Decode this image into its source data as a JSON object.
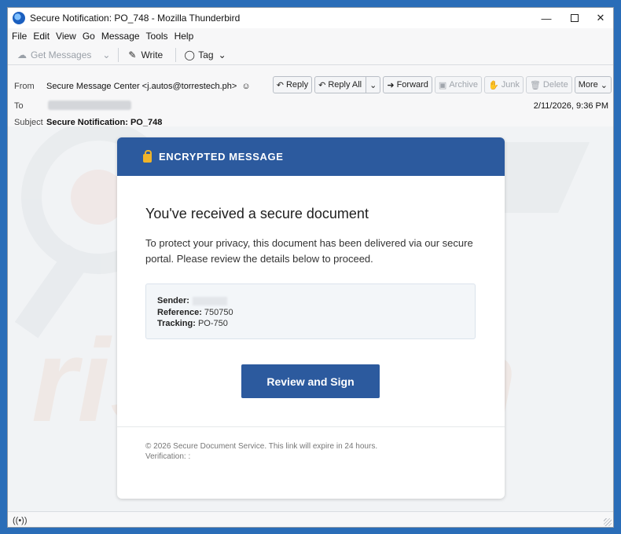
{
  "window": {
    "title": "Secure Notification: PO_748 - Mozilla Thunderbird"
  },
  "menu": [
    "File",
    "Edit",
    "View",
    "Go",
    "Message",
    "Tools",
    "Help"
  ],
  "toolbar": {
    "get_messages": "Get Messages",
    "write": "Write",
    "tag": "Tag"
  },
  "header": {
    "from_label": "From",
    "from_value": "Secure Message Center <j.autos@torrestech.ph>",
    "to_label": "To",
    "subject_label": "Subject",
    "subject_value": "Secure Notification: PO_748",
    "date": "2/11/2026, 9:36 PM",
    "actions": {
      "reply": "Reply",
      "reply_all": "Reply All",
      "forward": "Forward",
      "archive": "Archive",
      "junk": "Junk",
      "delete": "Delete",
      "more": "More"
    }
  },
  "email": {
    "banner": "ENCRYPTED MESSAGE",
    "title": "You've received a secure document",
    "body": "To protect your privacy, this document has been delivered via our secure portal. Please review the details below to proceed.",
    "details": {
      "sender_label": "Sender:",
      "reference_label": "Reference:",
      "reference_value": "750750",
      "tracking_label": "Tracking:",
      "tracking_value": "PO-750"
    },
    "cta": "Review and Sign",
    "footer_line1": "© 2026 Secure Document Service. This link will expire in 24 hours.",
    "footer_line2": "Verification: :"
  },
  "watermark": {
    "text": "risk.com"
  },
  "colors": {
    "accent": "#2c5a9e",
    "lock": "#f0b429",
    "desktop": "#2a6db8"
  },
  "icons": [
    "app-icon",
    "minimize-icon",
    "maximize-icon",
    "close-icon",
    "get-messages-icon",
    "write-icon",
    "tag-icon",
    "chevron-down-icon",
    "contact-icon",
    "reply-icon",
    "reply-all-icon",
    "forward-icon",
    "archive-icon",
    "junk-icon",
    "delete-icon",
    "lock-icon",
    "wifi-icon"
  ]
}
